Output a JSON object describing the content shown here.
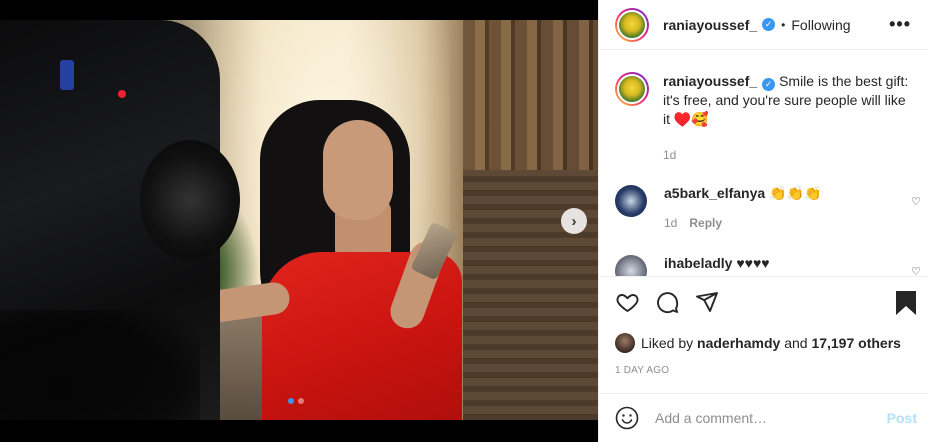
{
  "post": {
    "author": "raniayoussef_",
    "follow_status": "Following",
    "bullet": "•",
    "more_label": "•••",
    "caption": "Smile is the best gift: it's free, and you're sure people will like it ♥️🥰",
    "caption_time": "1d",
    "carousel": {
      "next_arrow": "›",
      "current_slide": 1,
      "total_slides": 2
    }
  },
  "comments": [
    {
      "username": "a5bark_elfanya",
      "text": "👏👏👏",
      "time": "1d",
      "reply_label": "Reply"
    },
    {
      "username": "ihabeladly",
      "text": "♥♥♥♥"
    }
  ],
  "likes": {
    "prefix": "Liked by",
    "user": "naderhamdy",
    "suffix": "and",
    "count": "17,197 others"
  },
  "date": "1 DAY AGO",
  "add_comment": {
    "placeholder": "Add a comment…",
    "post_label": "Post"
  },
  "colors": {
    "accent": "#3897f0",
    "post_disabled": "#b2dffc",
    "muted": "#8e8e8e"
  }
}
